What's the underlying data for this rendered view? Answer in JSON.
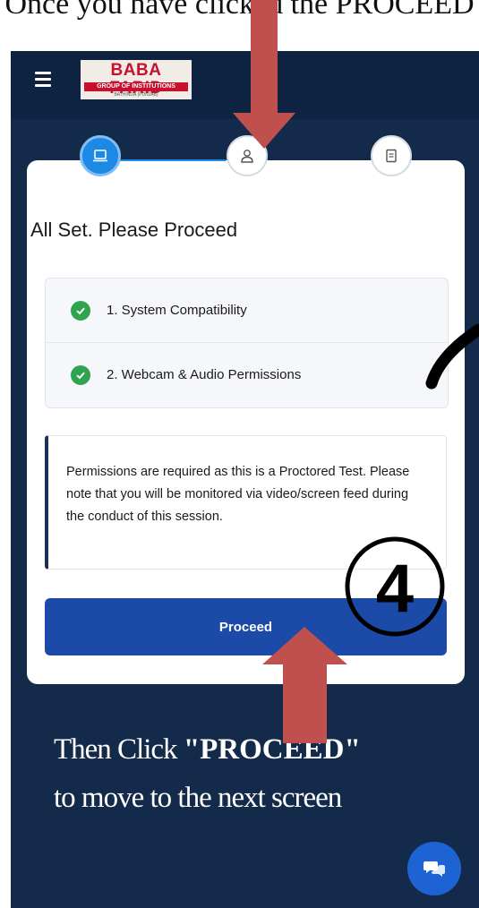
{
  "caption_top": "Once you have clicked the PROCEED",
  "appbar": {
    "logo_title": "BABA FARID",
    "logo_subtitle": "GROUP OF INSTITUTIONS",
    "logo_tagline": "BATHINDA (PUNJAB)"
  },
  "stepper": {
    "steps": [
      {
        "icon": "laptop-icon",
        "state": "active"
      },
      {
        "icon": "user-icon",
        "state": "inactive"
      },
      {
        "icon": "document-icon",
        "state": "inactive"
      }
    ]
  },
  "card": {
    "title": "All Set. Please Proceed",
    "checks": [
      {
        "label": "1. System Compatibility"
      },
      {
        "label": "2. Webcam & Audio Permissions"
      }
    ],
    "notice": "Permissions are required as this is a Proctored Test. Please note that you will be monitored via video/screen feed during the conduct of this session.",
    "proceed_label": "Proceed"
  },
  "annotation": {
    "step_number": "4",
    "caption_line1_prefix": "Then Click ",
    "caption_line1_bold": "\"PROCEED\"",
    "caption_line2": "to move to the next screen"
  },
  "colors": {
    "background": "#132a4a",
    "primary": "#1b4aa8",
    "accent": "#1e88e5",
    "success": "#2ea44f",
    "annotation_arrow": "#c0504d"
  }
}
